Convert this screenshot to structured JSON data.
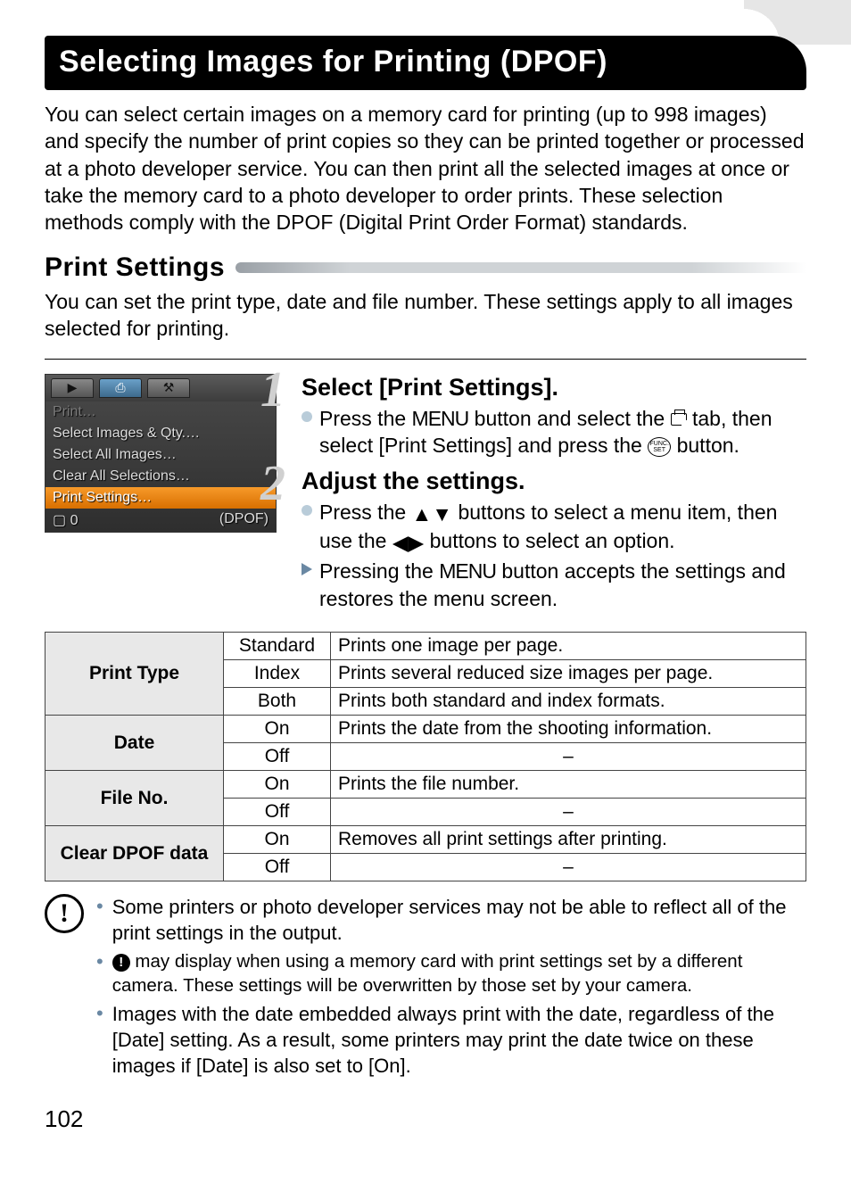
{
  "title": "Selecting Images for Printing (DPOF)",
  "intro": "You can select certain images on a memory card for printing (up to 998 images) and specify the number of print copies so they can be printed together or processed at a photo developer service. You can then print all the selected images at once or take the memory card to a photo developer to order prints. These selection methods comply with the DPOF (Digital Print Order Format) standards.",
  "sub_heading": "Print Settings",
  "sub_intro": "You can set the print type, date and file number. These settings apply to all images selected for printing.",
  "shot": {
    "tab1_glyph": "▶",
    "tab2_glyph": "⎙",
    "tab3_glyph": "⚒",
    "rows": [
      "Print…",
      "Select Images & Qty.…",
      "Select All Images…",
      "Clear All Selections…",
      "Print Settings…"
    ],
    "footer_left": "▢ 0",
    "footer_right": "(DPOF)"
  },
  "steps": {
    "s1": {
      "num": "1",
      "title": "Select [Print Settings].",
      "b1a": "Press the ",
      "b1_menu": "MENU",
      "b1b": " button and select the ",
      "b1c": " tab, then select [Print Settings] and press the ",
      "b1d": " button."
    },
    "s2": {
      "num": "2",
      "title": "Adjust the settings.",
      "b1a": "Press the ",
      "b1b": " buttons to select a menu item, then use the ",
      "b1c": " buttons to select an option.",
      "b2a": "Pressing the ",
      "b2_menu": "MENU",
      "b2b": " button accepts the settings and restores the menu screen."
    }
  },
  "table": {
    "r1": {
      "name": "Print Type",
      "o1": "Standard",
      "d1": "Prints one image per page.",
      "o2": "Index",
      "d2": "Prints several reduced size images per page.",
      "o3": "Both",
      "d3": "Prints both standard and index formats."
    },
    "r2": {
      "name": "Date",
      "o1": "On",
      "d1": "Prints the date from the shooting information.",
      "o2": "Off",
      "d2": "–"
    },
    "r3": {
      "name": "File No.",
      "o1": "On",
      "d1": "Prints the file number.",
      "o2": "Off",
      "d2": "–"
    },
    "r4": {
      "name": "Clear DPOF data",
      "o1": "On",
      "d1": "Removes all print settings after printing.",
      "o2": "Off",
      "d2": "–"
    }
  },
  "caution": {
    "c1": "Some printers or photo developer services may not be able to reflect all of the print settings in the output.",
    "c2a": " may display when using a memory card with print settings set by a different camera. These settings will be overwritten by those set by your camera.",
    "c3": "Images with the date embedded always print with the date, regardless of the [Date] setting. As a result, some printers may print the date twice on these images if [Date] is also set to [On]."
  },
  "page_num": "102",
  "glyph": {
    "up_down": "▲▼",
    "left_right": "◀▶",
    "func1": "FUNC.",
    "func2": "SET",
    "bang": "!",
    "bullet": "•"
  }
}
